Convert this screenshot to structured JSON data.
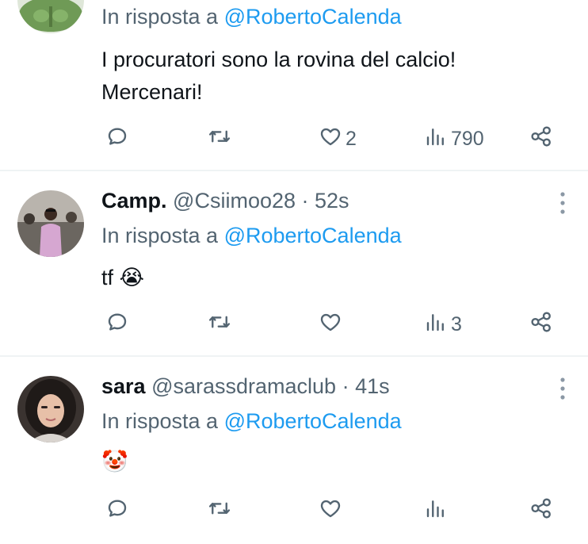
{
  "tweets": [
    {
      "reply_prefix": "In risposta a",
      "reply_mention": "@RobertoCalenda",
      "text_line1": "I procuratori sono la rovina del calcio!",
      "text_line2": "Mercenari!",
      "actions": {
        "likes": "2",
        "views": "790"
      }
    },
    {
      "name": "Camp.",
      "handle_time": "@Csiimoo28 · 52s",
      "reply_prefix": "In risposta a",
      "reply_mention": "@RobertoCalenda",
      "text": "tf",
      "emoji": "😭",
      "actions": {
        "likes": "",
        "views": "3"
      }
    },
    {
      "name": "sara",
      "handle_time": "@sarassdramaclub · 41s",
      "reply_prefix": "In risposta a",
      "reply_mention": "@RobertoCalenda",
      "emoji": "🤡",
      "actions": {
        "likes": "",
        "views": ""
      }
    }
  ],
  "icons": {
    "reply": "reply-icon",
    "retweet": "retweet-icon",
    "like": "heart-icon",
    "views": "views-icon",
    "share": "share-icon",
    "more": "more-vertical-icon"
  },
  "colors": {
    "link": "#1d9bf0",
    "muted": "#536471",
    "text": "#0f1419",
    "divider": "#eff3f4"
  }
}
